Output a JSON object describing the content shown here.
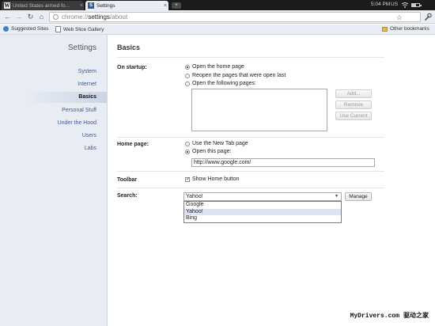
{
  "tabs": [
    {
      "title": "United States armed fo...",
      "favicon": "W",
      "active": false
    },
    {
      "title": "Settings",
      "favicon": "S",
      "active": true
    }
  ],
  "tabbar": {
    "new_tab_icon": "plus-icon",
    "close_icon": "×"
  },
  "status": {
    "time": "5:04 PM",
    "locale": "US",
    "battery_level": 0.6
  },
  "address_bar": {
    "scheme": "chrome://",
    "host": "settings",
    "path": "/about"
  },
  "bookmarks": {
    "items": [
      {
        "label": "Suggested Sites",
        "icon": "ie-icon"
      },
      {
        "label": "Web Slice Gallery",
        "icon": "document-icon"
      }
    ],
    "other": "Other bookmarks"
  },
  "sidebar": {
    "title": "Settings",
    "items": [
      {
        "label": "System"
      },
      {
        "label": "Internet"
      },
      {
        "label": "Basics",
        "selected": true
      },
      {
        "label": "Personal Stuff"
      },
      {
        "label": "Under the Hood"
      },
      {
        "label": "Users"
      },
      {
        "label": "Labs"
      }
    ]
  },
  "main": {
    "title": "Basics",
    "startup": {
      "label": "On startup:",
      "options": [
        {
          "label": "Open the home page",
          "checked": true
        },
        {
          "label": "Reopen the pages that were open last",
          "checked": false
        },
        {
          "label": "Open the following pages:",
          "checked": false
        }
      ],
      "buttons": {
        "add": "Add...",
        "remove": "Remove",
        "use_current": "Use Current"
      }
    },
    "home_page": {
      "label": "Home page:",
      "options": [
        {
          "label": "Use the New Tab page",
          "checked": false
        },
        {
          "label": "Open this page:",
          "checked": true
        }
      ],
      "url": "http://www.google.com/"
    },
    "toolbar": {
      "label": "Toolbar",
      "show_home_label": "Show Home button",
      "show_home_checked": true
    },
    "search": {
      "label": "Search:",
      "selected": "Yahoo!",
      "options": [
        "Google",
        "Yahoo!",
        "Bing"
      ],
      "manage_label": "Manage"
    }
  },
  "watermark": {
    "latin": "MyDrivers.com",
    "cjk": "驱动之家"
  }
}
